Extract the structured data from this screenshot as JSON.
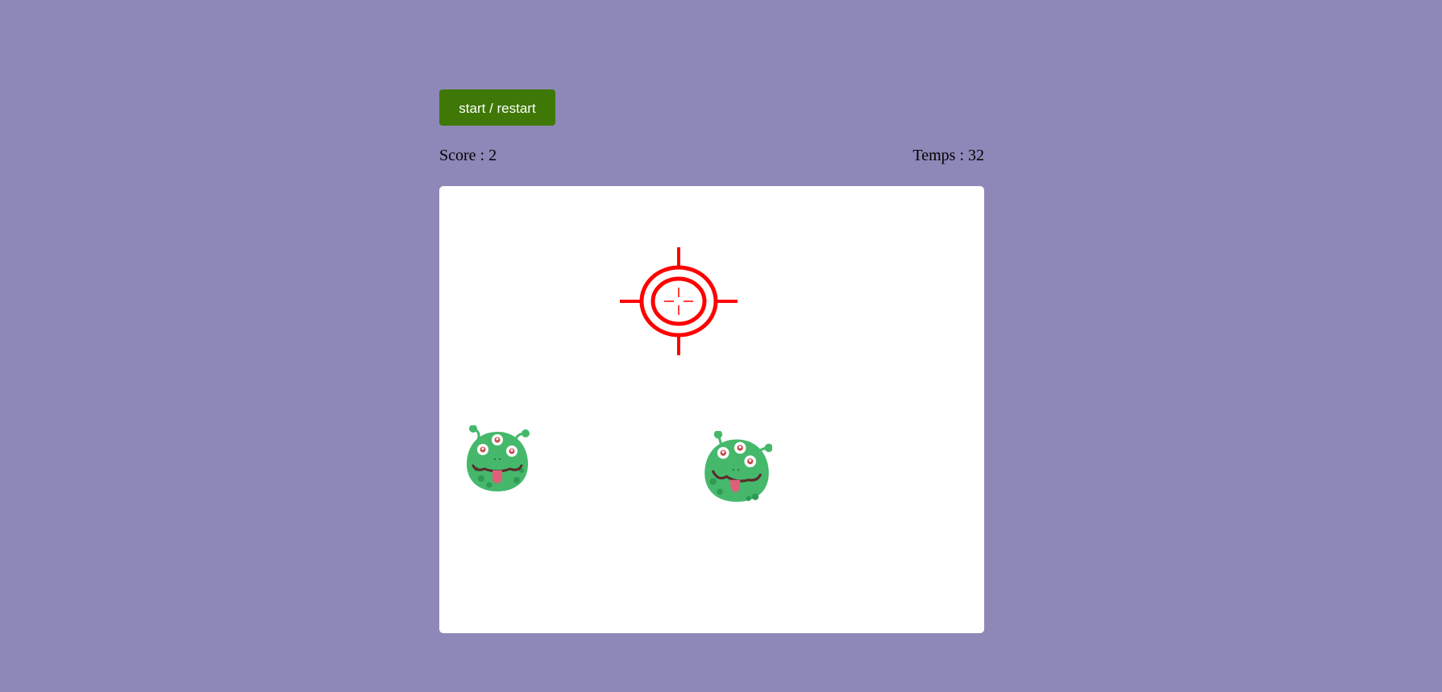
{
  "controls": {
    "start_label": "start / restart"
  },
  "stats": {
    "score_label": "Score : 2",
    "time_label": "Temps : 32"
  },
  "game": {
    "score": 2,
    "time": 32,
    "cursor_icon": "crosshair-icon",
    "enemy_icon": "alien-icon",
    "colors": {
      "background": "#8e88b8",
      "button": "#3f7806",
      "crosshair": "#ff0000",
      "alien_body": "#45b86b"
    }
  }
}
